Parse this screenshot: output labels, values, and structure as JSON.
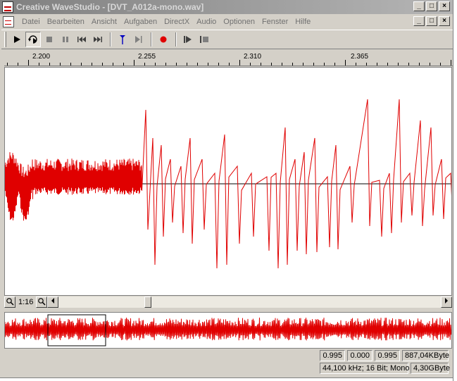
{
  "window": {
    "title": "Creative WaveStudio - [DVT_A012a-mono.wav]",
    "minimize": "_",
    "maximize": "□",
    "close": "×"
  },
  "menu": {
    "items": [
      "Datei",
      "Bearbeiten",
      "Ansicht",
      "Aufgaben",
      "DirectX",
      "Audio",
      "Optionen",
      "Fenster",
      "Hilfe"
    ]
  },
  "toolbar": {
    "buttons": [
      {
        "name": "play",
        "icon": "play-icon"
      },
      {
        "name": "loop-play",
        "icon": "loop-play-icon",
        "pressed": true
      },
      {
        "name": "stop",
        "icon": "stop-icon"
      },
      {
        "name": "pause",
        "icon": "pause-icon"
      },
      {
        "name": "previous",
        "icon": "skip-back-icon"
      },
      {
        "name": "next",
        "icon": "skip-forward-icon"
      },
      {
        "name": "marker",
        "icon": "marker-icon"
      },
      {
        "name": "play-to-marker",
        "icon": "play-to-end-icon"
      },
      {
        "name": "record",
        "icon": "record-icon"
      },
      {
        "name": "play-selection",
        "icon": "play-selection-icon"
      },
      {
        "name": "stop-selection",
        "icon": "stop-selection-icon"
      }
    ]
  },
  "ruler": {
    "labels": [
      "2.200",
      "2.255",
      "2.310",
      "2.365"
    ]
  },
  "zoom": {
    "level": "1:16"
  },
  "status": {
    "sel_start": "0.995",
    "sel_length": "0.000",
    "sel_end": "0.995",
    "size": "887,04KByte",
    "format": "44,100 kHz; 16 Bit; Mono",
    "free": "4,30GByte"
  },
  "colors": {
    "waveform": "#e00000",
    "background": "#ffffff",
    "chrome": "#d4d0c8"
  }
}
